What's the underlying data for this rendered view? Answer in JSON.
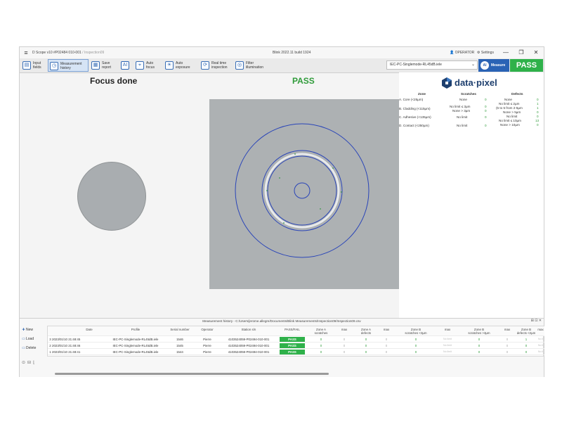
{
  "titlebar": {
    "menu_icon": "hamburger-icon",
    "app_title": "D Scope v10 #P02484 010-001",
    "breadcrumb": "/ Inspection09",
    "build": "Blink 2022.11 build 1924",
    "operator": "OPERATOR",
    "settings": "Settings",
    "minimize": "—",
    "maximize": "❐",
    "close": "✕"
  },
  "toolbar": {
    "input_fields": "Input\nfields",
    "measurement_history": "Measurement\nhistory",
    "save_report": "Save\nreport",
    "ai_label": "AI",
    "auto_focus": "Auto\nfocus",
    "auto_exposure": "Auto\nexposure",
    "real_time_inspection": "Real time\ninspection",
    "filter_illumination": "Filter\nillumination",
    "profile_value": "IEC-PC-Singlemode-RL45dB.iele",
    "measure_ai": "AI",
    "measure": "Measure",
    "pass": "PASS"
  },
  "main": {
    "focus_status": "Focus done",
    "result": "PASS"
  },
  "results_panel": {
    "logo": "data·pixel",
    "headers": {
      "zone": "Zone",
      "scratches": "Scratches",
      "defects": "Defects"
    },
    "rows": [
      {
        "zone": "A. Core (<25µm)",
        "scratches": "None",
        "sv": "0",
        "defects": [
          "None"
        ],
        "dv": [
          "0"
        ]
      },
      {
        "zone": "",
        "scratches": "",
        "sv": "",
        "defects": [
          "No limit ≤ 2µm"
        ],
        "dv": [
          "1"
        ]
      },
      {
        "zone": "B. Cladding (<115µm)",
        "scratches": "No limit ≤ 3µm",
        "sv": "0",
        "defects": [
          "(5 to 5 from 2-5µm"
        ],
        "dv": [
          "1"
        ]
      },
      {
        "zone": "",
        "scratches": "None > 3µm",
        "sv": "0",
        "defects": [
          "None > 5µm"
        ],
        "dv": [
          "0"
        ]
      },
      {
        "zone": "C. Adhesive (<135µm)",
        "scratches": "No limit",
        "sv": "0",
        "defects": [
          "No limit"
        ],
        "dv": [
          "0"
        ]
      },
      {
        "zone": "",
        "scratches": "",
        "sv": "",
        "defects": [
          "No limit ≤ 10µm"
        ],
        "dv": [
          "13"
        ]
      },
      {
        "zone": "D. Contact (<250µm)",
        "scratches": "No limit",
        "sv": "0",
        "defects": [
          "None > 10µm"
        ],
        "dv": [
          "0"
        ]
      }
    ]
  },
  "history": {
    "title": "Measurement history - C:/Users/jerome.allegre/Documents/Blink Measurements/Inspection09/Inspection09.csv",
    "controls": "⊞ ⊡ ✕",
    "buttons": {
      "new": "New",
      "load": "Load",
      "delete": "Delete"
    },
    "columns": [
      "Date",
      "Profile",
      "Serial number",
      "Operator",
      "Station s/n",
      "PASS/FAIL",
      "Zone A\nscratches",
      "max",
      "Zone A\ndefects",
      "max",
      "Zone B\nscratches <3µm",
      "max",
      "Zone B\nscratches >3µm",
      "max",
      "Zone B\ndefects <2µm",
      "max"
    ],
    "rows": [
      {
        "idx": "3",
        "date": "2023/01/10 21:48:45",
        "profile": "IEC-PC-Singlemode-RL45dB.iele",
        "serial": "1546",
        "operator": "Pierre",
        "station": "4103524059-P02494-010-001",
        "result": "PASS",
        "za_s": "0",
        "za_s_max": "0",
        "za_d": "0",
        "za_d_max": "0",
        "zb_s": "0",
        "zb_s_max": "No limit",
        "zb_s2": "0",
        "zb_s2_max": "0",
        "zb_d": "1",
        "zb_d_max": "No li"
      },
      {
        "idx": "2",
        "date": "2023/01/10 21:48:46",
        "profile": "IEC-PC-Singlemode-RL45dB.iele",
        "serial": "1545",
        "operator": "Pierre",
        "station": "4103524059-P02494-010-001",
        "result": "PASS",
        "za_s": "0",
        "za_s_max": "0",
        "za_d": "0",
        "za_d_max": "0",
        "zb_s": "0",
        "zb_s_max": "No limit",
        "zb_s2": "0",
        "zb_s2_max": "0",
        "zb_d": "0",
        "zb_d_max": "No li"
      },
      {
        "idx": "1",
        "date": "2023/01/10 21:48:41",
        "profile": "IEC-PC-Singlemode-RL45dB.iele",
        "serial": "1544",
        "operator": "Pierre",
        "station": "4103524059-P02494-010-001",
        "result": "PASS",
        "za_s": "0",
        "za_s_max": "0",
        "za_d": "0",
        "za_d_max": "0",
        "zb_s": "0",
        "zb_s_max": "No limit",
        "zb_s2": "0",
        "zb_s2_max": "0",
        "zb_d": "0",
        "zb_d_max": "No li"
      }
    ]
  },
  "colors": {
    "accent": "#2a63b5",
    "pass": "#2fb14a",
    "ring": "#2a45b8"
  }
}
